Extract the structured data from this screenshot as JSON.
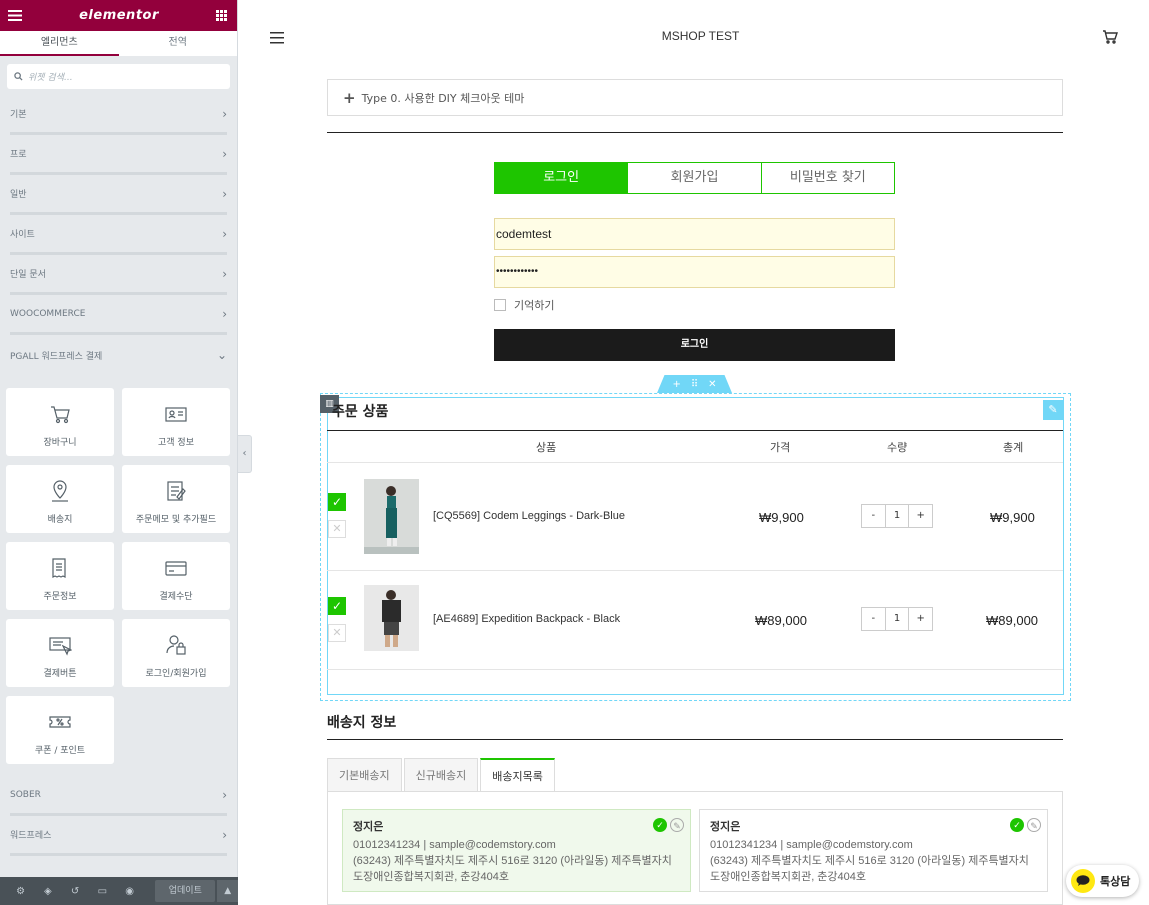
{
  "panel": {
    "logo": "elementor",
    "tabs": [
      "엘리먼츠",
      "전역"
    ],
    "search_placeholder": "위젯 검색...",
    "categories_top": [
      "기본",
      "프로",
      "일반",
      "사이트",
      "단일 문서",
      "WOOCOMMERCE",
      "PGALL 워드프레스 결제"
    ],
    "widgets": [
      {
        "label": "장바구니",
        "icon": "cart-icon"
      },
      {
        "label": "고객 정보",
        "icon": "id-card-icon"
      },
      {
        "label": "배송지",
        "icon": "map-pin-icon"
      },
      {
        "label": "주문메모 및 추가필드",
        "icon": "memo-icon"
      },
      {
        "label": "주문정보",
        "icon": "receipt-icon"
      },
      {
        "label": "결제수단",
        "icon": "credit-card-icon"
      },
      {
        "label": "결제버튼",
        "icon": "pay-button-icon"
      },
      {
        "label": "로그인/회원가입",
        "icon": "user-lock-icon"
      },
      {
        "label": "쿠폰 / 포인트",
        "icon": "coupon-icon"
      }
    ],
    "categories_bottom": [
      "SOBER",
      "워드프레스"
    ],
    "update_label": "업데이트"
  },
  "site": {
    "title": "MSHOP TEST",
    "add_section": "Type 0. 사용한 DIY 체크아웃 테마",
    "login_tabs": [
      "로그인",
      "회원가입",
      "비밀번호 찾기"
    ],
    "username": "codemtest",
    "password": "••••••••••••",
    "remember": "기억하기",
    "login_button": "로그인"
  },
  "order": {
    "title": "주문 상품",
    "headers": {
      "product": "상품",
      "price": "가격",
      "qty": "수량",
      "total": "총계"
    },
    "items": [
      {
        "name": "[CQ5569] Codem Leggings - Dark-Blue",
        "price": "₩9,900",
        "qty": "1",
        "total": "₩9,900"
      },
      {
        "name": "[AE4689] Expedition Backpack - Black",
        "price": "₩89,000",
        "qty": "1",
        "total": "₩89,000"
      }
    ],
    "minus": "-",
    "plus": "+"
  },
  "shipping": {
    "title": "배송지 정보",
    "tabs": [
      "기본배송지",
      "신규배송지",
      "배송지목록"
    ],
    "addresses": [
      {
        "name": "정지은",
        "line1": "01012341234 | sample@codemstory.com",
        "line2": "(63243) 제주특별자치도 제주시 516로 3120 (아라일동) 제주특별자치",
        "line3": "도장애인종합복지회관, 춘강404호"
      },
      {
        "name": "정지은",
        "line1": "01012341234 | sample@codemstory.com",
        "line2": "(63243) 제주특별자치도 제주시 516로 3120 (아라일동) 제주특별자치",
        "line3": "도장애인종합복지회관, 춘강404호"
      }
    ]
  },
  "chat": {
    "label": "톡상담"
  },
  "colors": {
    "brand": "#93003c",
    "accent": "#1ec500",
    "edit": "#71d7f7"
  }
}
